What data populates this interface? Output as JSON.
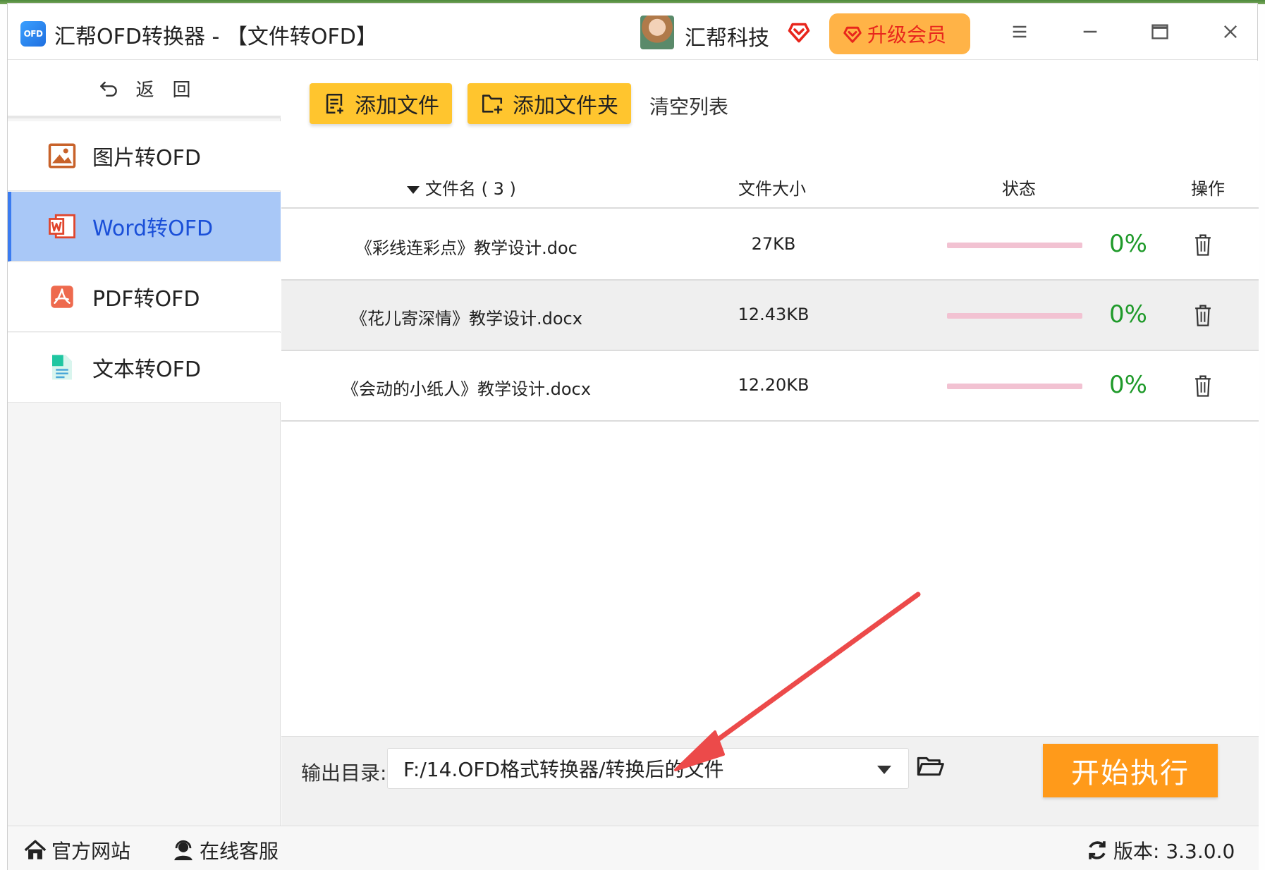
{
  "window": {
    "logo_text": "OFD",
    "title": "汇帮OFD转换器 - 【文件转OFD】",
    "user_name": "汇帮科技",
    "upgrade_label": "升级会员"
  },
  "sidebar": {
    "back_label": "返　回",
    "items": [
      {
        "label": "图片转OFD",
        "icon": "image-icon"
      },
      {
        "label": "Word转OFD",
        "icon": "word-icon",
        "active": true
      },
      {
        "label": "PDF转OFD",
        "icon": "pdf-icon"
      },
      {
        "label": "文本转OFD",
        "icon": "text-file-icon"
      }
    ]
  },
  "toolbar": {
    "add_file": "添加文件",
    "add_folder": "添加文件夹",
    "clear_list": "清空列表"
  },
  "table": {
    "headers": {
      "name": "文件名 ( 3 )",
      "size": "文件大小",
      "status": "状态",
      "op": "操作"
    },
    "rows": [
      {
        "name": "《彩线连彩点》教学设计.doc",
        "size": "27KB",
        "percent": "0%",
        "progress": 0
      },
      {
        "name": "《花儿寄深情》教学设计.docx",
        "size": "12.43KB",
        "percent": "0%",
        "progress": 0
      },
      {
        "name": "《会动的小纸人》教学设计.docx",
        "size": "12.20KB",
        "percent": "0%",
        "progress": 0
      }
    ]
  },
  "output": {
    "label": "输出目录:",
    "path": "F:/14.OFD格式转换器/转换后的文件",
    "start_label": "开始执行"
  },
  "footer": {
    "website": "官方网站",
    "support": "在线客服",
    "version": "版本:  3.3.0.0"
  },
  "colors": {
    "accent_yellow": "#ffc52e",
    "start_orange": "#ff9a1a",
    "active_nav_bg": "#a9c8f7",
    "active_nav_text": "#1a4fd8",
    "percent_green": "#1f9a2a",
    "progress_track": "#f2c2d2",
    "annotation_red": "#ec4a4a"
  }
}
